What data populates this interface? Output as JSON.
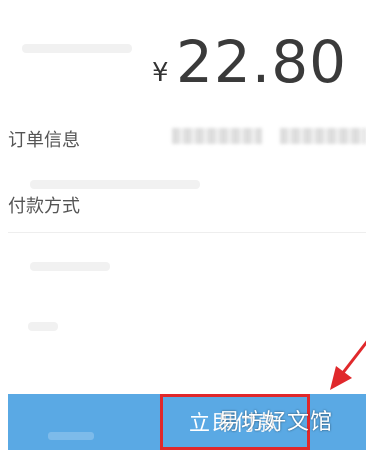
{
  "payment": {
    "currency_symbol": "¥",
    "amount": "22.80"
  },
  "rows": {
    "order_info_label": "订单信息",
    "payment_method_label": "付款方式"
  },
  "pay_button": {
    "label": "立即付款"
  },
  "watermark": "易坊好文馆",
  "colors": {
    "pay_bar": "#5aa9e4",
    "highlight_box": "#e0282b",
    "arrow": "#e0282b"
  },
  "icons": {
    "annotation_arrow": "red-arrow"
  }
}
